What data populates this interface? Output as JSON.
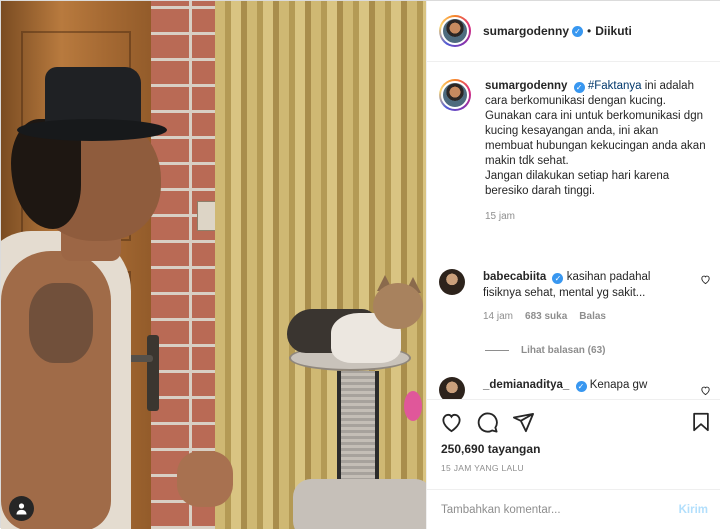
{
  "post": {
    "author": "sumargodenny",
    "follow_separator": "•",
    "follow_status": "Diikuti"
  },
  "caption": {
    "author": "sumargodenny",
    "hashtag": "#Faktanya",
    "text_line1": " ini adalah cara berkomunikasi dengan kucing.",
    "text_line2": "Gunakan cara ini untuk berkomunikasi dgn kucing kesayangan anda, ini akan membuat hubungan kekucingan anda akan makin tdk sehat.",
    "text_line3": "Jangan dilakukan setiap hari karena beresiko darah tinggi.",
    "time": "15 jam"
  },
  "comments": [
    {
      "author": "babecabiita",
      "text": "kasihan padahal fisiknya sehat, mental yg sakit...",
      "time": "14 jam",
      "likes": "683 suka",
      "reply_label": "Balas",
      "view_replies": "Lihat balasan (63)"
    },
    {
      "author": "_demianaditya_",
      "text": "Kenapa gw"
    }
  ],
  "stats": {
    "views": "250,690 tayangan",
    "time_ago": "15 JAM YANG LALU"
  },
  "comment_box": {
    "placeholder": "Tambahkan komentar...",
    "send_label": "Kirim"
  },
  "colors": {
    "verified": "#3897f0",
    "link": "#00376b",
    "send_disabled": "#b2dffc"
  }
}
